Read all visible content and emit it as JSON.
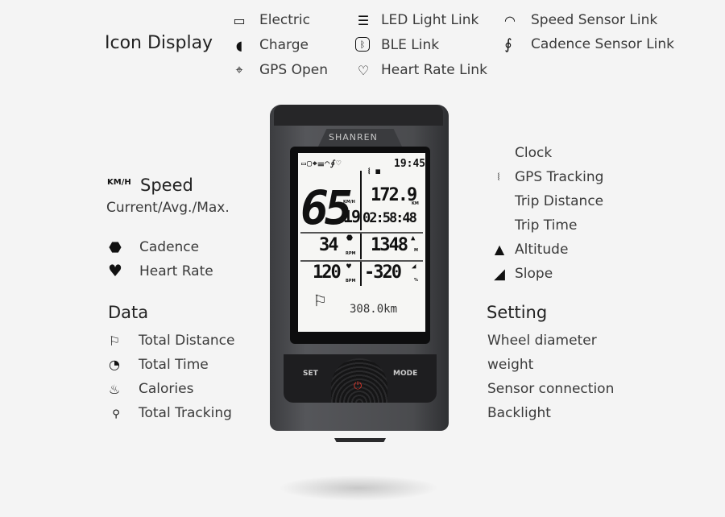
{
  "icon_display": {
    "title": "Icon Display",
    "items": [
      {
        "label": "Electric",
        "icon": "battery-icon"
      },
      {
        "label": "Charge",
        "icon": "plug-icon"
      },
      {
        "label": "GPS Open",
        "icon": "satellite-icon"
      },
      {
        "label": "LED Light Link",
        "icon": "headlight-icon"
      },
      {
        "label": "BLE Link",
        "icon": "bluetooth-icon"
      },
      {
        "label": "Heart Rate Link",
        "icon": "heart-pulse-icon"
      },
      {
        "label": "Speed Sensor Link",
        "icon": "speedometer-icon"
      },
      {
        "label": "Cadence Sensor Link",
        "icon": "cadence-sensor-icon"
      }
    ]
  },
  "speed": {
    "unit": "KM/H",
    "title": "Speed",
    "subtitle": "Current/Avg./Max."
  },
  "left_items": [
    {
      "label": "Cadence",
      "icon": "cadence-icon"
    },
    {
      "label": "Heart Rate",
      "icon": "heart-icon"
    }
  ],
  "data_section": {
    "title": "Data",
    "items": [
      {
        "label": "Total Distance",
        "icon": "flag-icon"
      },
      {
        "label": "Total Time",
        "icon": "clock-icon"
      },
      {
        "label": "Calories",
        "icon": "flame-icon"
      },
      {
        "label": "Total Tracking",
        "icon": "route-icon"
      }
    ]
  },
  "right_items": [
    {
      "label": "Clock",
      "icon": ""
    },
    {
      "label": "GPS Tracking",
      "icon": "gps-tracking-icon"
    },
    {
      "label": "Trip Distance",
      "icon": ""
    },
    {
      "label": "Trip Time",
      "icon": ""
    },
    {
      "label": "Altitude",
      "icon": "mountain-icon"
    },
    {
      "label": "Slope",
      "icon": "slope-icon"
    }
  ],
  "setting": {
    "title": "Setting",
    "items": [
      "Wheel diameter",
      "weight",
      "Sensor connection",
      "Backlight"
    ]
  },
  "device": {
    "brand": "SHANREN",
    "set_label": "SET",
    "mode_label": "MODE",
    "power_color": "#d9382c",
    "screen": {
      "clock": "19:45",
      "speed": "65",
      "speed_decimal": "19",
      "speed_unit": "KM/H",
      "trip_distance": "172.9",
      "distance_unit": "KM",
      "trip_time": "02:58:48",
      "cadence": "34",
      "cadence_unit": "RPM",
      "altitude": "1348",
      "altitude_unit": "M",
      "heart_rate": "120",
      "heart_unit": "BPM",
      "slope": "-320",
      "slope_unit": "%",
      "total_distance": "308.0km"
    }
  }
}
